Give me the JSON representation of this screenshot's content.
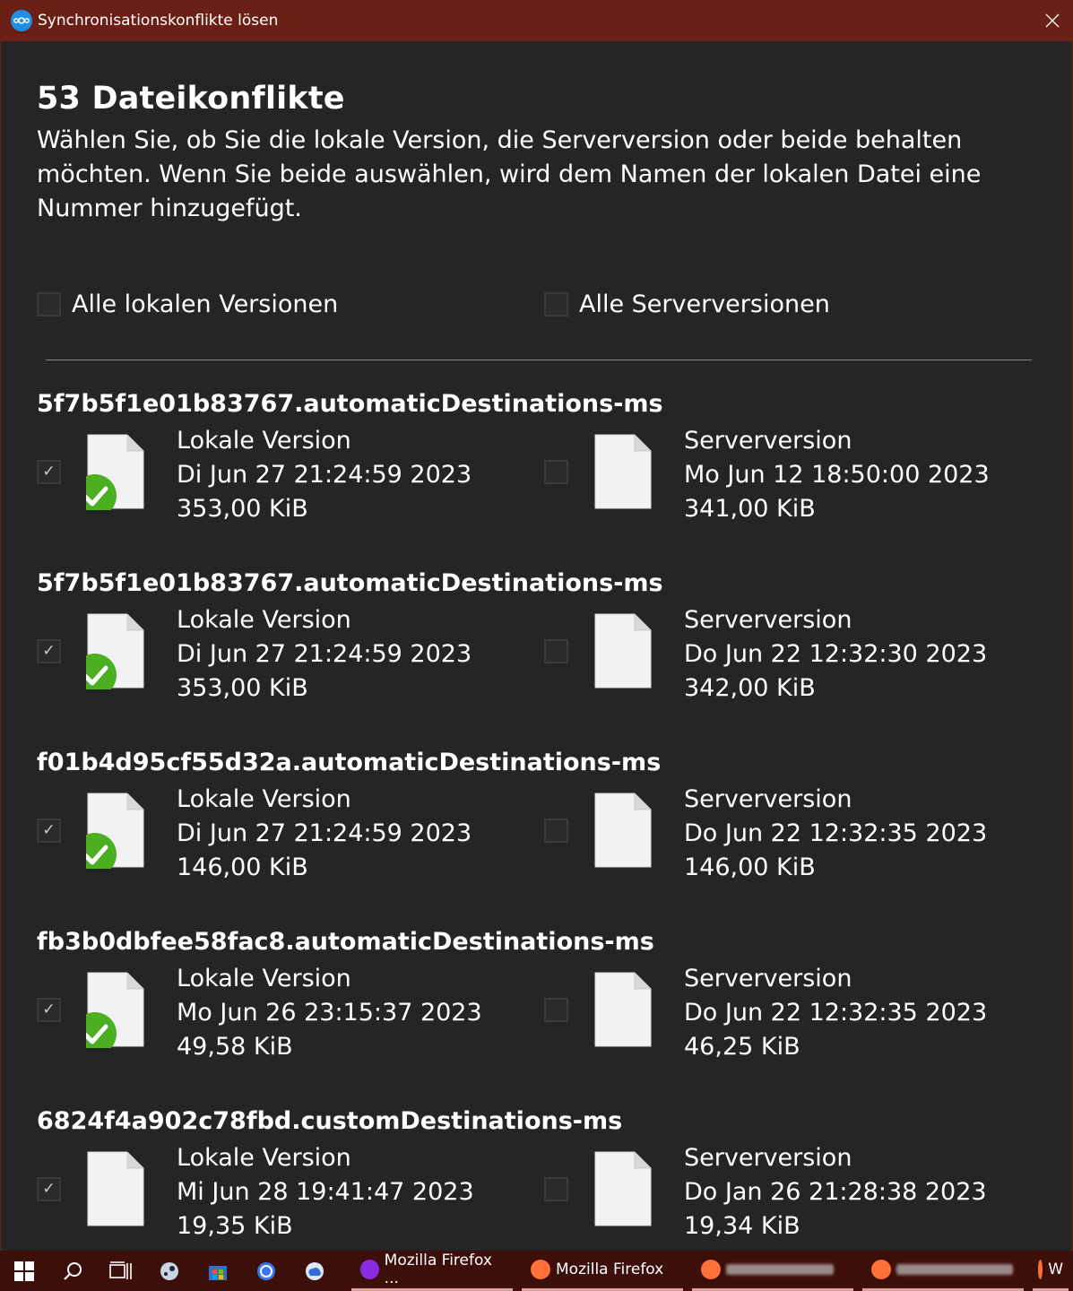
{
  "window": {
    "title": "Synchronisationskonflikte lösen",
    "close_glyph": "✕"
  },
  "header": {
    "title": "53 Dateikonflikte",
    "description": "Wählen Sie, ob Sie die lokale Version, die Serverversion oder beide behalten möchten. Wenn Sie beide auswählen, wird dem Namen der lokalen Datei eine Nummer hinzugefügt."
  },
  "select_all": {
    "local_label": "Alle lokalen Versionen",
    "server_label": "Alle Serverversionen"
  },
  "conflicts": [
    {
      "filename": "5f7b5f1e01b83767.automaticDestinations-ms",
      "local": {
        "label": "Lokale Version",
        "date": "Di Jun 27 21:24:59 2023",
        "size": "353,00 KiB",
        "checked": true,
        "synced_badge": true
      },
      "server": {
        "label": "Serverversion",
        "date": "Mo Jun 12 18:50:00 2023",
        "size": "341,00 KiB",
        "checked": false
      }
    },
    {
      "filename": "5f7b5f1e01b83767.automaticDestinations-ms",
      "local": {
        "label": "Lokale Version",
        "date": "Di Jun 27 21:24:59 2023",
        "size": "353,00 KiB",
        "checked": true,
        "synced_badge": true
      },
      "server": {
        "label": "Serverversion",
        "date": "Do Jun 22 12:32:30 2023",
        "size": "342,00 KiB",
        "checked": false
      }
    },
    {
      "filename": "f01b4d95cf55d32a.automaticDestinations-ms",
      "local": {
        "label": "Lokale Version",
        "date": "Di Jun 27 21:24:59 2023",
        "size": "146,00 KiB",
        "checked": true,
        "synced_badge": true
      },
      "server": {
        "label": "Serverversion",
        "date": "Do Jun 22 12:32:35 2023",
        "size": "146,00 KiB",
        "checked": false
      }
    },
    {
      "filename": "fb3b0dbfee58fac8.automaticDestinations-ms",
      "local": {
        "label": "Lokale Version",
        "date": "Mo Jun 26 23:15:37 2023",
        "size": "49,58 KiB",
        "checked": true,
        "synced_badge": true
      },
      "server": {
        "label": "Serverversion",
        "date": "Do Jun 22 12:32:35 2023",
        "size": "46,25 KiB",
        "checked": false
      }
    },
    {
      "filename": "6824f4a902c78fbd.customDestinations-ms",
      "local": {
        "label": "Lokale Version",
        "date": "Mi Jun 28 19:41:47 2023",
        "size": "19,35 KiB",
        "checked": true,
        "synced_badge": false
      },
      "server": {
        "label": "Serverversion",
        "date": "Do Jan 26 21:28:38 2023",
        "size": "19,34 KiB",
        "checked": false
      }
    }
  ],
  "taskbar": {
    "apps": [
      {
        "label": "Mozilla Firefox ...",
        "icon": "firefox-private-icon"
      },
      {
        "label": "Mozilla Firefox",
        "icon": "firefox-icon"
      },
      {
        "label": "",
        "icon": "firefox-icon"
      },
      {
        "label": "",
        "icon": "firefox-icon"
      },
      {
        "label": "W",
        "icon": "firefox-icon"
      }
    ]
  },
  "colors": {
    "titlebar": "#6b2016",
    "background": "#252525",
    "taskbar": "#3c0f0a",
    "success_badge": "#4caf1f"
  }
}
